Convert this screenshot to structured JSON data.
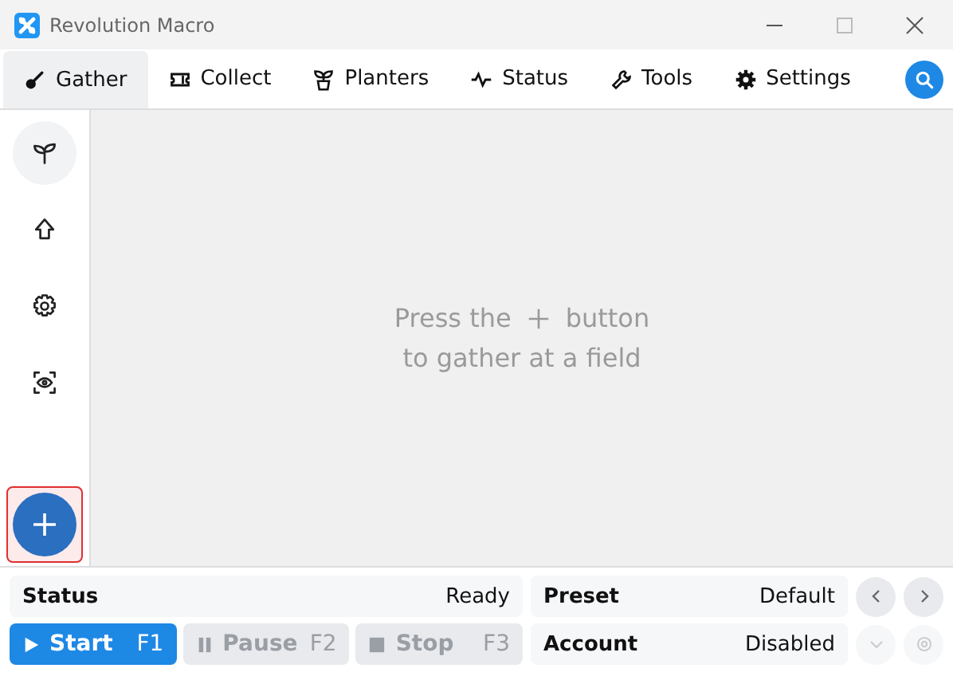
{
  "window": {
    "title": "Revolution Macro"
  },
  "tabs": [
    {
      "label": "Gather",
      "selected": true
    },
    {
      "label": "Collect",
      "selected": false
    },
    {
      "label": "Planters",
      "selected": false
    },
    {
      "label": "Status",
      "selected": false
    },
    {
      "label": "Tools",
      "selected": false
    },
    {
      "label": "Settings",
      "selected": false
    }
  ],
  "sidebar": {
    "items": [
      {
        "selected": true
      },
      {
        "selected": false
      },
      {
        "selected": false
      },
      {
        "selected": false
      }
    ],
    "add_button": {
      "highlighted": true
    }
  },
  "empty_message": {
    "before": "Press the",
    "after": "button",
    "line2": "to gather at a field"
  },
  "status": {
    "label": "Status",
    "value": "Ready"
  },
  "preset": {
    "label": "Preset",
    "value": "Default"
  },
  "account": {
    "label": "Account",
    "value": "Disabled"
  },
  "controls": [
    {
      "kind": "start",
      "label": "Start",
      "key": "F1",
      "disabled": false
    },
    {
      "kind": "pause",
      "label": "Pause",
      "key": "F2",
      "disabled": true
    },
    {
      "kind": "stop",
      "label": "Stop",
      "key": "F3",
      "disabled": true
    }
  ],
  "preset_buttons": [
    {
      "kind": "prev",
      "disabled": false
    },
    {
      "kind": "next",
      "disabled": false
    }
  ],
  "account_buttons": [
    {
      "kind": "dropdown",
      "disabled": true
    },
    {
      "kind": "settings",
      "disabled": true
    }
  ]
}
